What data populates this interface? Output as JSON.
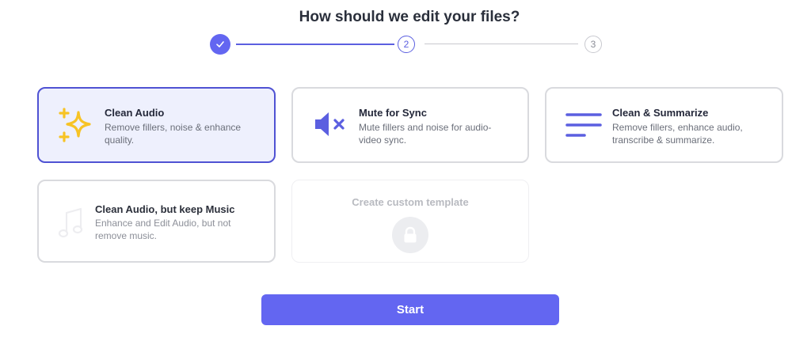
{
  "header": {
    "title": "How should we edit your files?"
  },
  "stepper": {
    "steps": [
      {
        "label": "",
        "state": "done"
      },
      {
        "label": "2",
        "state": "current"
      },
      {
        "label": "3",
        "state": "upcoming"
      }
    ]
  },
  "options": [
    {
      "title": "Clean Audio",
      "description": "Remove fillers, noise & enhance quality.",
      "icon": "sparkle-icon",
      "selected": true
    },
    {
      "title": "Mute for Sync",
      "description": "Mute fillers and noise for audio-video sync.",
      "icon": "speaker-mute-icon",
      "selected": false
    },
    {
      "title": "Clean & Summarize",
      "description": "Remove fillers, enhance audio, transcribe & summarize.",
      "icon": "text-lines-icon",
      "selected": false
    },
    {
      "title": "Clean Audio, but keep Music",
      "description": "Enhance and Edit Audio, but not remove music.",
      "icon": "music-note-icon",
      "selected": false
    }
  ],
  "custom_template": {
    "title": "Create custom template",
    "icon": "lock-icon"
  },
  "footer": {
    "start_label": "Start"
  },
  "colors": {
    "accent": "#6366f1",
    "selected_bg": "#eef0fd",
    "sparkle": "#f7c325"
  }
}
